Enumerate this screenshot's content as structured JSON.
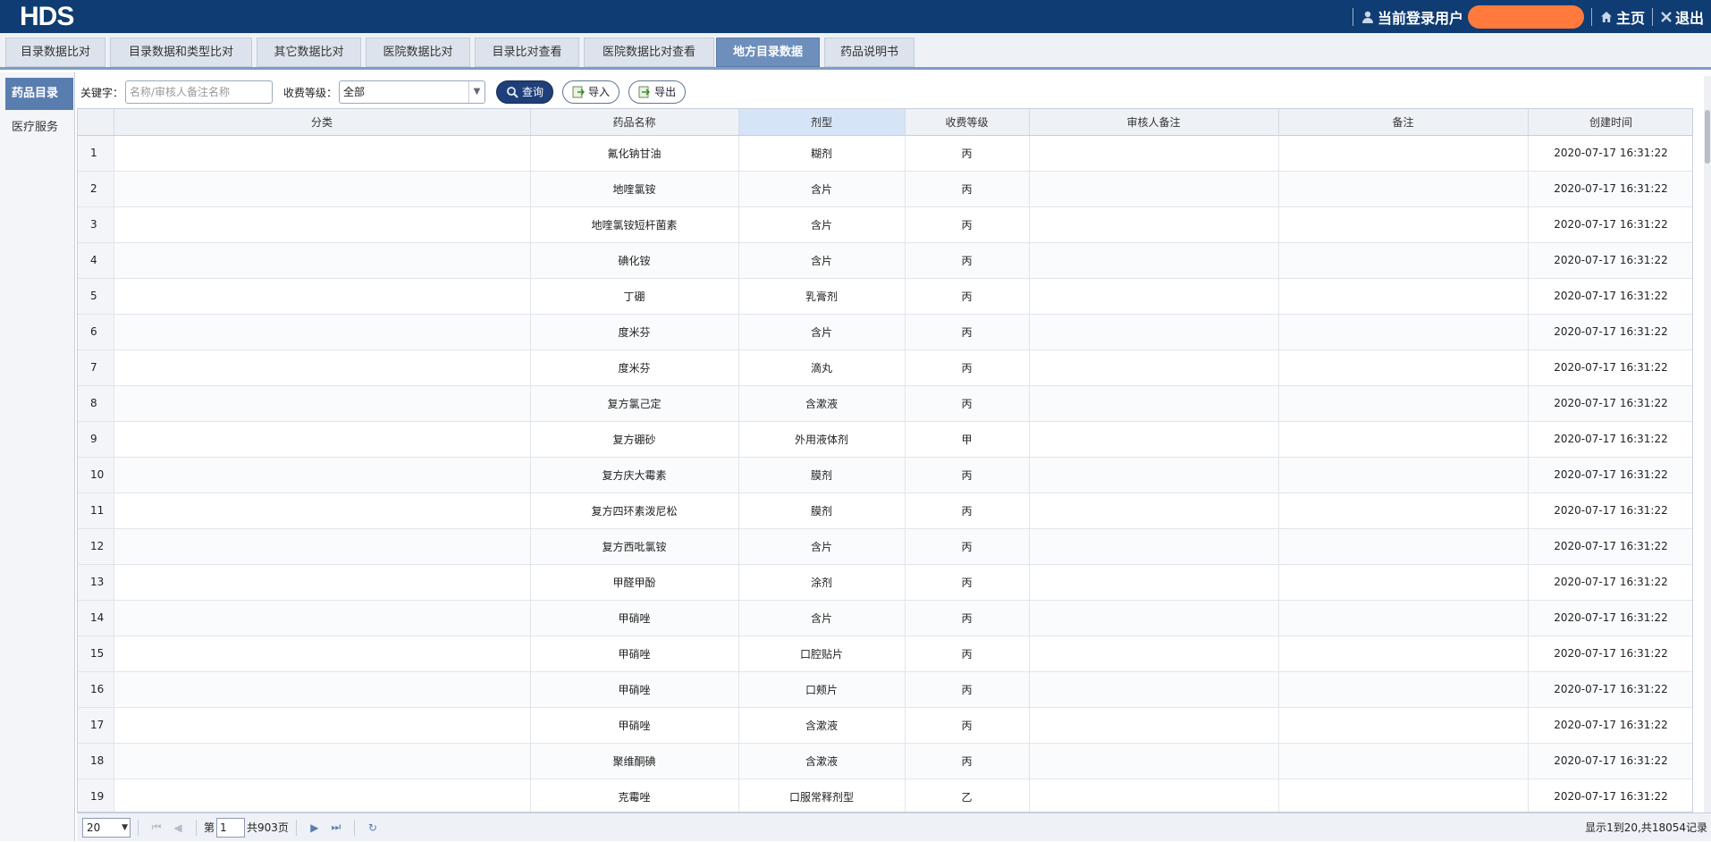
{
  "header": {
    "logo": "HDS",
    "user_label": "当前登录用户",
    "home_label": "主页",
    "logout_label": "退出"
  },
  "tabs": [
    {
      "label": "目录数据比对",
      "active": false
    },
    {
      "label": "目录数据和类型比对",
      "active": false
    },
    {
      "label": "其它数据比对",
      "active": false
    },
    {
      "label": "医院数据比对",
      "active": false
    },
    {
      "label": "目录比对查看",
      "active": false
    },
    {
      "label": "医院数据比对查看",
      "active": false
    },
    {
      "label": "地方目录数据",
      "active": true
    },
    {
      "label": "药品说明书",
      "active": false
    }
  ],
  "sidebar": {
    "items": [
      {
        "label": "药品目录",
        "active": true
      },
      {
        "label": "医疗服务",
        "active": false
      }
    ]
  },
  "toolbar": {
    "keyword_label": "关键字：",
    "keyword_placeholder": "名称/审核人备注名称",
    "level_label": "收费等级：",
    "level_value": "全部",
    "search_label": "查询",
    "import_label": "导入",
    "export_label": "导出"
  },
  "table": {
    "columns": [
      "",
      "分类",
      "药品名称",
      "剂型",
      "收费等级",
      "审核人备注",
      "备注",
      "创建时间"
    ],
    "rows": [
      {
        "n": "1",
        "cat": "",
        "name": "氟化钠甘油",
        "form": "糊剂",
        "level": "丙",
        "audit": "",
        "note": "",
        "time": "2020-07-17 16:31:22"
      },
      {
        "n": "2",
        "cat": "",
        "name": "地喹氯铵",
        "form": "含片",
        "level": "丙",
        "audit": "",
        "note": "",
        "time": "2020-07-17 16:31:22"
      },
      {
        "n": "3",
        "cat": "",
        "name": "地喹氯铵短杆菌素",
        "form": "含片",
        "level": "丙",
        "audit": "",
        "note": "",
        "time": "2020-07-17 16:31:22"
      },
      {
        "n": "4",
        "cat": "",
        "name": "碘化铵",
        "form": "含片",
        "level": "丙",
        "audit": "",
        "note": "",
        "time": "2020-07-17 16:31:22"
      },
      {
        "n": "5",
        "cat": "",
        "name": "丁硼",
        "form": "乳膏剂",
        "level": "丙",
        "audit": "",
        "note": "",
        "time": "2020-07-17 16:31:22"
      },
      {
        "n": "6",
        "cat": "",
        "name": "度米芬",
        "form": "含片",
        "level": "丙",
        "audit": "",
        "note": "",
        "time": "2020-07-17 16:31:22"
      },
      {
        "n": "7",
        "cat": "",
        "name": "度米芬",
        "form": "滴丸",
        "level": "丙",
        "audit": "",
        "note": "",
        "time": "2020-07-17 16:31:22"
      },
      {
        "n": "8",
        "cat": "",
        "name": "复方氯己定",
        "form": "含漱液",
        "level": "丙",
        "audit": "",
        "note": "",
        "time": "2020-07-17 16:31:22"
      },
      {
        "n": "9",
        "cat": "",
        "name": "复方硼砂",
        "form": "外用液体剂",
        "level": "甲",
        "audit": "",
        "note": "",
        "time": "2020-07-17 16:31:22"
      },
      {
        "n": "10",
        "cat": "",
        "name": "复方庆大霉素",
        "form": "膜剂",
        "level": "丙",
        "audit": "",
        "note": "",
        "time": "2020-07-17 16:31:22"
      },
      {
        "n": "11",
        "cat": "",
        "name": "复方四环素泼尼松",
        "form": "膜剂",
        "level": "丙",
        "audit": "",
        "note": "",
        "time": "2020-07-17 16:31:22"
      },
      {
        "n": "12",
        "cat": "",
        "name": "复方西吡氯铵",
        "form": "含片",
        "level": "丙",
        "audit": "",
        "note": "",
        "time": "2020-07-17 16:31:22"
      },
      {
        "n": "13",
        "cat": "",
        "name": "甲醛甲酚",
        "form": "涂剂",
        "level": "丙",
        "audit": "",
        "note": "",
        "time": "2020-07-17 16:31:22"
      },
      {
        "n": "14",
        "cat": "",
        "name": "甲硝唑",
        "form": "含片",
        "level": "丙",
        "audit": "",
        "note": "",
        "time": "2020-07-17 16:31:22"
      },
      {
        "n": "15",
        "cat": "",
        "name": "甲硝唑",
        "form": "口腔贴片",
        "level": "丙",
        "audit": "",
        "note": "",
        "time": "2020-07-17 16:31:22"
      },
      {
        "n": "16",
        "cat": "",
        "name": "甲硝唑",
        "form": "口颊片",
        "level": "丙",
        "audit": "",
        "note": "",
        "time": "2020-07-17 16:31:22"
      },
      {
        "n": "17",
        "cat": "",
        "name": "甲硝唑",
        "form": "含漱液",
        "level": "丙",
        "audit": "",
        "note": "",
        "time": "2020-07-17 16:31:22"
      },
      {
        "n": "18",
        "cat": "",
        "name": "聚维酮碘",
        "form": "含漱液",
        "level": "丙",
        "audit": "",
        "note": "",
        "time": "2020-07-17 16:31:22"
      },
      {
        "n": "19",
        "cat": "",
        "name": "克霉唑",
        "form": "口服常释剂型",
        "level": "乙",
        "audit": "",
        "note": "",
        "time": "2020-07-17 16:31:22"
      }
    ]
  },
  "pager": {
    "page_size": "20",
    "page_prefix": "第",
    "current_page": "1",
    "total_pages_text": "共903页",
    "summary": "显示1到20,共18054记录"
  }
}
